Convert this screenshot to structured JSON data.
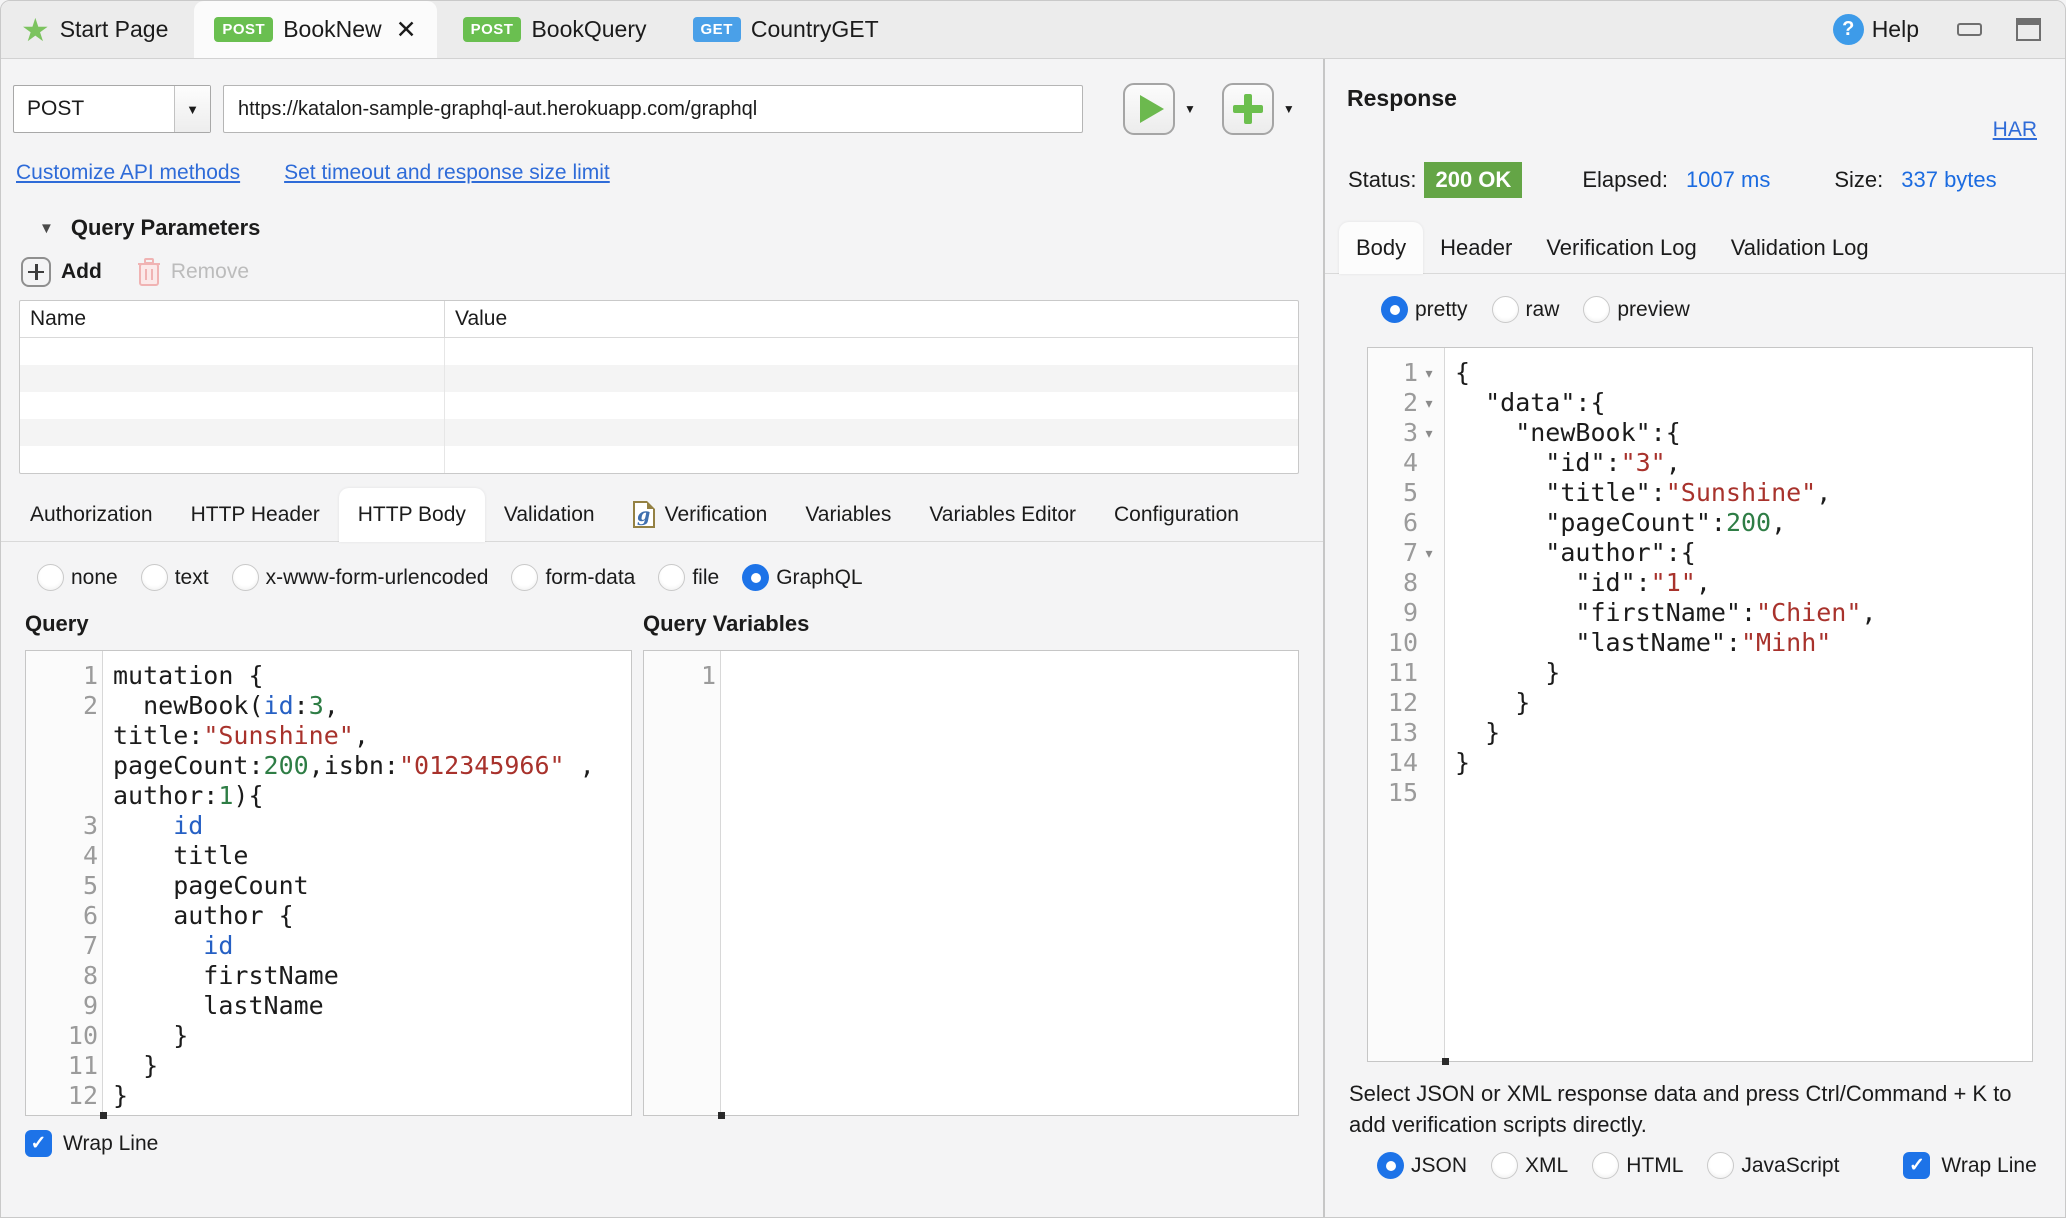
{
  "tab_bar": {
    "tabs": [
      {
        "label": "Start Page",
        "icon": "star",
        "method": null,
        "active": false,
        "closable": false
      },
      {
        "label": "BookNew",
        "icon": null,
        "method": "POST",
        "active": true,
        "closable": true
      },
      {
        "label": "BookQuery",
        "icon": null,
        "method": "POST",
        "active": false,
        "closable": false
      },
      {
        "label": "CountryGET",
        "icon": null,
        "method": "GET",
        "active": false,
        "closable": false
      }
    ],
    "help_label": "Help"
  },
  "request": {
    "method": "POST",
    "url": "https://katalon-sample-graphql-aut.herokuapp.com/graphql",
    "api_links": [
      "Customize API methods",
      "Set timeout and response size limit"
    ],
    "query_parameters": {
      "title": "Query Parameters",
      "add_label": "Add",
      "remove_label": "Remove",
      "columns": [
        "Name",
        "Value"
      ],
      "empty_rows": 5
    },
    "tabs": [
      "Authorization",
      "HTTP Header",
      "HTTP Body",
      "Validation",
      "Verification",
      "Variables",
      "Variables Editor",
      "Configuration"
    ],
    "active_tab": "HTTP Body",
    "body_types": [
      "none",
      "text",
      "x-www-form-urlencoded",
      "form-data",
      "file",
      "GraphQL"
    ],
    "selected_body_type": "GraphQL",
    "query_label": "Query",
    "query_variables_label": "Query Variables",
    "wrap_line_label": "Wrap Line",
    "wrap_line_checked": true,
    "query_code": {
      "lines": [
        {
          "no": "1",
          "segments": [
            {
              "t": "mutation {",
              "c": "default"
            }
          ]
        },
        {
          "no": "2",
          "segments": [
            {
              "t": "  newBook(",
              "c": "default"
            },
            {
              "t": "id",
              "c": "blue"
            },
            {
              "t": ":",
              "c": "default"
            },
            {
              "t": "3",
              "c": "green"
            },
            {
              "t": ",",
              "c": "default"
            }
          ]
        },
        {
          "no": "",
          "segments": [
            {
              "t": "title:",
              "c": "default"
            },
            {
              "t": "\"Sunshine\"",
              "c": "red"
            },
            {
              "t": ",",
              "c": "default"
            }
          ]
        },
        {
          "no": "",
          "segments": [
            {
              "t": "pageCount:",
              "c": "default"
            },
            {
              "t": "200",
              "c": "green"
            },
            {
              "t": ",isbn:",
              "c": "default"
            },
            {
              "t": "\"012345966\"",
              "c": "red"
            },
            {
              "t": " ,",
              "c": "default"
            }
          ]
        },
        {
          "no": "",
          "segments": [
            {
              "t": "author:",
              "c": "default"
            },
            {
              "t": "1",
              "c": "green"
            },
            {
              "t": "){",
              "c": "default"
            }
          ]
        },
        {
          "no": "3",
          "segments": [
            {
              "t": "    ",
              "c": "default"
            },
            {
              "t": "id",
              "c": "blue"
            }
          ]
        },
        {
          "no": "4",
          "segments": [
            {
              "t": "    title",
              "c": "default"
            }
          ]
        },
        {
          "no": "5",
          "segments": [
            {
              "t": "    pageCount",
              "c": "default"
            }
          ]
        },
        {
          "no": "6",
          "segments": [
            {
              "t": "    author {",
              "c": "default"
            }
          ]
        },
        {
          "no": "7",
          "segments": [
            {
              "t": "      ",
              "c": "default"
            },
            {
              "t": "id",
              "c": "blue"
            }
          ]
        },
        {
          "no": "8",
          "segments": [
            {
              "t": "      firstName",
              "c": "default"
            }
          ]
        },
        {
          "no": "9",
          "segments": [
            {
              "t": "      lastName",
              "c": "default"
            }
          ]
        },
        {
          "no": "10",
          "segments": [
            {
              "t": "    }",
              "c": "default"
            }
          ]
        },
        {
          "no": "11",
          "segments": [
            {
              "t": "  }",
              "c": "default"
            }
          ]
        },
        {
          "no": "12",
          "segments": [
            {
              "t": "}",
              "c": "default"
            }
          ]
        }
      ]
    },
    "query_variables_code": {
      "lines": [
        {
          "no": "1",
          "segments": []
        }
      ]
    }
  },
  "response": {
    "title": "Response",
    "har_label": "HAR",
    "status_label": "Status:",
    "status_value": "200 OK",
    "elapsed_label": "Elapsed:",
    "elapsed_value": "1007 ms",
    "size_label": "Size:",
    "size_value": "337 bytes",
    "tabs": [
      "Body",
      "Header",
      "Verification Log",
      "Validation Log"
    ],
    "active_tab": "Body",
    "view_modes": [
      "pretty",
      "raw",
      "preview"
    ],
    "selected_view_mode": "pretty",
    "body_code": {
      "lines": [
        {
          "no": "1",
          "fold": true,
          "segments": [
            {
              "t": "{",
              "c": "default"
            }
          ]
        },
        {
          "no": "2",
          "fold": true,
          "segments": [
            {
              "t": "  \"data\":{",
              "c": "default"
            }
          ]
        },
        {
          "no": "3",
          "fold": true,
          "segments": [
            {
              "t": "    \"newBook\":{",
              "c": "default"
            }
          ]
        },
        {
          "no": "4",
          "segments": [
            {
              "t": "      \"id\":",
              "c": "default"
            },
            {
              "t": "\"3\"",
              "c": "red"
            },
            {
              "t": ",",
              "c": "default"
            }
          ]
        },
        {
          "no": "5",
          "segments": [
            {
              "t": "      \"title\":",
              "c": "default"
            },
            {
              "t": "\"Sunshine\"",
              "c": "red"
            },
            {
              "t": ",",
              "c": "default"
            }
          ]
        },
        {
          "no": "6",
          "segments": [
            {
              "t": "      \"pageCount\":",
              "c": "default"
            },
            {
              "t": "200",
              "c": "green"
            },
            {
              "t": ",",
              "c": "default"
            }
          ]
        },
        {
          "no": "7",
          "fold": true,
          "segments": [
            {
              "t": "      \"author\":{",
              "c": "default"
            }
          ]
        },
        {
          "no": "8",
          "segments": [
            {
              "t": "        \"id\":",
              "c": "default"
            },
            {
              "t": "\"1\"",
              "c": "red"
            },
            {
              "t": ",",
              "c": "default"
            }
          ]
        },
        {
          "no": "9",
          "segments": [
            {
              "t": "        \"firstName\":",
              "c": "default"
            },
            {
              "t": "\"Chien\"",
              "c": "red"
            },
            {
              "t": ",",
              "c": "default"
            }
          ]
        },
        {
          "no": "10",
          "segments": [
            {
              "t": "        \"lastName\":",
              "c": "default"
            },
            {
              "t": "\"Minh\"",
              "c": "red"
            }
          ]
        },
        {
          "no": "11",
          "segments": [
            {
              "t": "      }",
              "c": "default"
            }
          ]
        },
        {
          "no": "12",
          "segments": [
            {
              "t": "    }",
              "c": "default"
            }
          ]
        },
        {
          "no": "13",
          "segments": [
            {
              "t": "  }",
              "c": "default"
            }
          ]
        },
        {
          "no": "14",
          "segments": [
            {
              "t": "}",
              "c": "default"
            }
          ]
        },
        {
          "no": "15",
          "segments": []
        }
      ]
    },
    "note": "Select JSON or XML response data and press Ctrl/Command + K to add verification scripts directly.",
    "formats": [
      "JSON",
      "XML",
      "HTML",
      "JavaScript"
    ],
    "selected_format": "JSON",
    "wrap_line_label": "Wrap Line",
    "wrap_line_checked": true
  },
  "colors": {
    "accent_blue": "#1d73e8",
    "link_blue": "#2e6bd8",
    "value_blue": "#1b6be0",
    "status_green": "#64a546",
    "post_badge_green": "#6abf50",
    "get_badge_blue": "#4aa0e8",
    "code_string_red": "#a8322c",
    "code_number_green": "#2e7d45",
    "code_id_blue": "#2660c4"
  }
}
